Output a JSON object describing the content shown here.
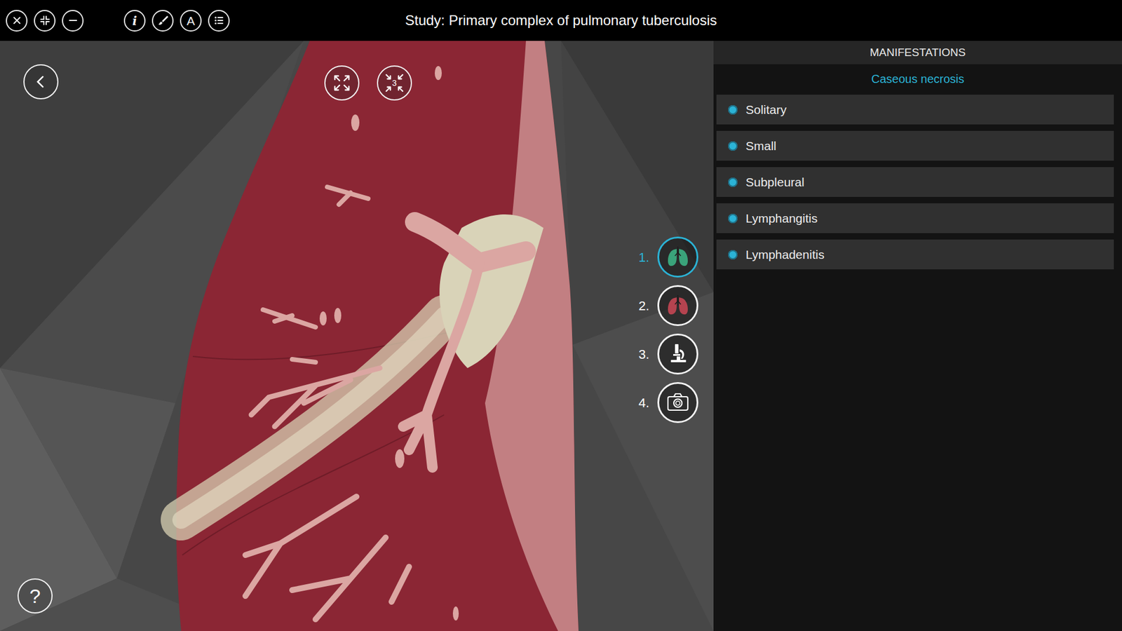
{
  "window": {
    "title": "Study: Primary complex of pulmonary tuberculosis"
  },
  "toolbar": {
    "info": "i",
    "text": "A"
  },
  "viewer": {
    "zoom_badge": "3",
    "help": "?"
  },
  "steps": [
    {
      "label": "1.",
      "selected": true
    },
    {
      "label": "2.",
      "selected": false
    },
    {
      "label": "3.",
      "selected": false
    },
    {
      "label": "4.",
      "selected": false
    }
  ],
  "panel": {
    "header": "MANIFESTATIONS",
    "subtitle": "Caseous necrosis",
    "items": [
      "Solitary",
      "Small",
      "Subpleural",
      "Lymphangitis",
      "Lymphadenitis"
    ]
  }
}
